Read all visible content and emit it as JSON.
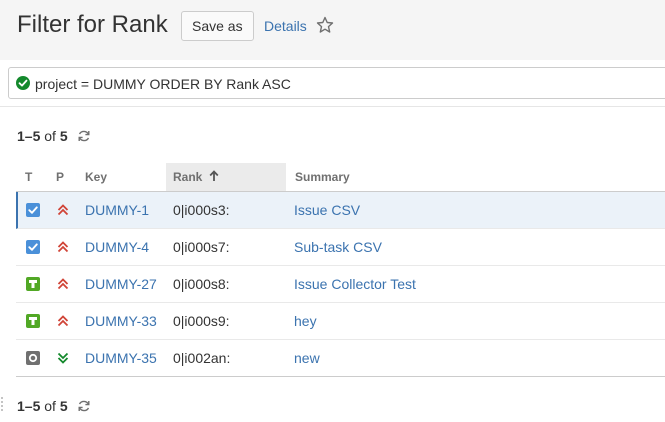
{
  "header": {
    "title": "Filter for Rank",
    "save_as_label": "Save as",
    "details_label": "Details",
    "star_icon": "star-icon"
  },
  "search": {
    "status_icon": "check-circle-icon",
    "query": "project = DUMMY ORDER BY Rank ASC"
  },
  "pager_top": {
    "range": "1–5",
    "of": "of",
    "total": "5"
  },
  "pager_bottom": {
    "range": "1–5",
    "of": "of",
    "total": "5"
  },
  "table": {
    "columns": {
      "type": "T",
      "priority": "P",
      "key": "Key",
      "rank": "Rank",
      "summary": "Summary"
    },
    "sort_icon": "arrow-up-icon",
    "rows": [
      {
        "type_icon": "task-icon",
        "priority_icon": "priority-high-icon",
        "key": "DUMMY-1",
        "rank": "0|i000s3:",
        "summary": "Issue CSV",
        "selected": true
      },
      {
        "type_icon": "task-icon",
        "priority_icon": "priority-high-icon",
        "key": "DUMMY-4",
        "rank": "0|i000s7:",
        "summary": "Sub-task CSV",
        "selected": false
      },
      {
        "type_icon": "test-icon",
        "priority_icon": "priority-high-icon",
        "key": "DUMMY-27",
        "rank": "0|i000s8:",
        "summary": "Issue Collector Test",
        "selected": false
      },
      {
        "type_icon": "test-icon",
        "priority_icon": "priority-high-icon",
        "key": "DUMMY-33",
        "rank": "0|i000s9:",
        "summary": "hey",
        "selected": false
      },
      {
        "type_icon": "subtask-icon",
        "priority_icon": "priority-low-icon",
        "key": "DUMMY-35",
        "rank": "0|i002an:",
        "summary": "new",
        "selected": false
      }
    ]
  },
  "colors": {
    "link": "#3b73af",
    "task_blue": "#4a90d9",
    "test_green": "#51a825",
    "subtask_gray": "#707070",
    "priority_high": "#d04437",
    "priority_low": "#14892c",
    "ok_green": "#14892c"
  }
}
